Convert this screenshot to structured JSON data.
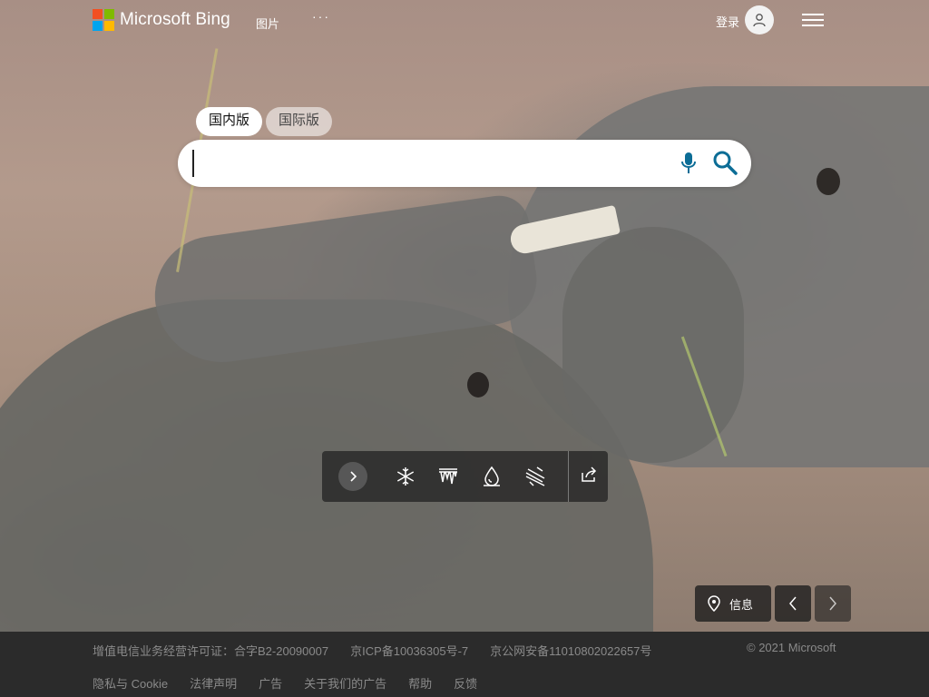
{
  "header": {
    "brand": "Microsoft Bing",
    "logo_colors": [
      "#f25022",
      "#7fba00",
      "#00a4ef",
      "#ffb900"
    ],
    "nav_images": "图片",
    "nav_more": "···",
    "signin": "登录"
  },
  "search": {
    "tabs": [
      {
        "label": "国内版",
        "active": true
      },
      {
        "label": "国际版",
        "active": false
      }
    ],
    "query_value": "",
    "mic_icon": "microphone-icon",
    "search_icon": "search-icon",
    "accent_color": "#0c6d96"
  },
  "toolbar": {
    "icons": [
      "chevron-right-icon",
      "snowflake-icon",
      "icicles-icon",
      "drop-icon",
      "wind-icon",
      "share-icon"
    ]
  },
  "controls": {
    "info_label": "信息",
    "info_icon": "location-pin-icon",
    "prev_icon": "chevron-left-icon",
    "next_icon": "chevron-right-icon"
  },
  "footer": {
    "row1": [
      "增值电信业务经营许可证：合字B2-20090007",
      "京ICP备10036305号-7",
      "京公网安备11010802022657号"
    ],
    "row2": [
      "隐私与 Cookie",
      "法律声明",
      "广告",
      "关于我们的广告",
      "帮助",
      "反馈"
    ],
    "copyright": "© 2021 Microsoft"
  }
}
